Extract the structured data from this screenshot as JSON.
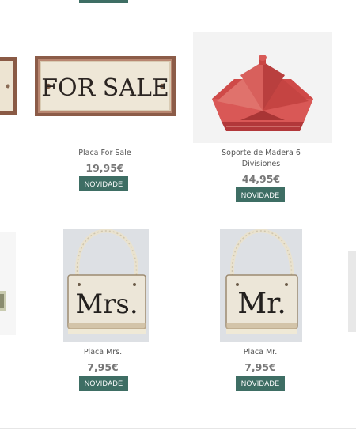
{
  "colors": {
    "accent": "#3e6e64",
    "price": "#777777",
    "name": "#555555"
  },
  "products": [
    {
      "name": "Placa For Sale",
      "price": "19,95€",
      "badge": "NOVIDADE",
      "image_text": "FOR SALE",
      "image_icon": "for-sale-sign-icon"
    },
    {
      "name": "Soporte de Madera 6 Divisiones",
      "price": "44,95€",
      "badge": "NOVIDADE",
      "image_icon": "wooden-organizer-icon"
    },
    {
      "name": "Placa Mrs.",
      "price": "7,95€",
      "badge": "NOVIDADE",
      "image_text": "Mrs.",
      "image_icon": "mrs-sign-icon"
    },
    {
      "name": "Placa Mr.",
      "price": "7,95€",
      "badge": "NOVIDADE",
      "image_text": "Mr.",
      "image_icon": "mr-sign-icon"
    }
  ]
}
